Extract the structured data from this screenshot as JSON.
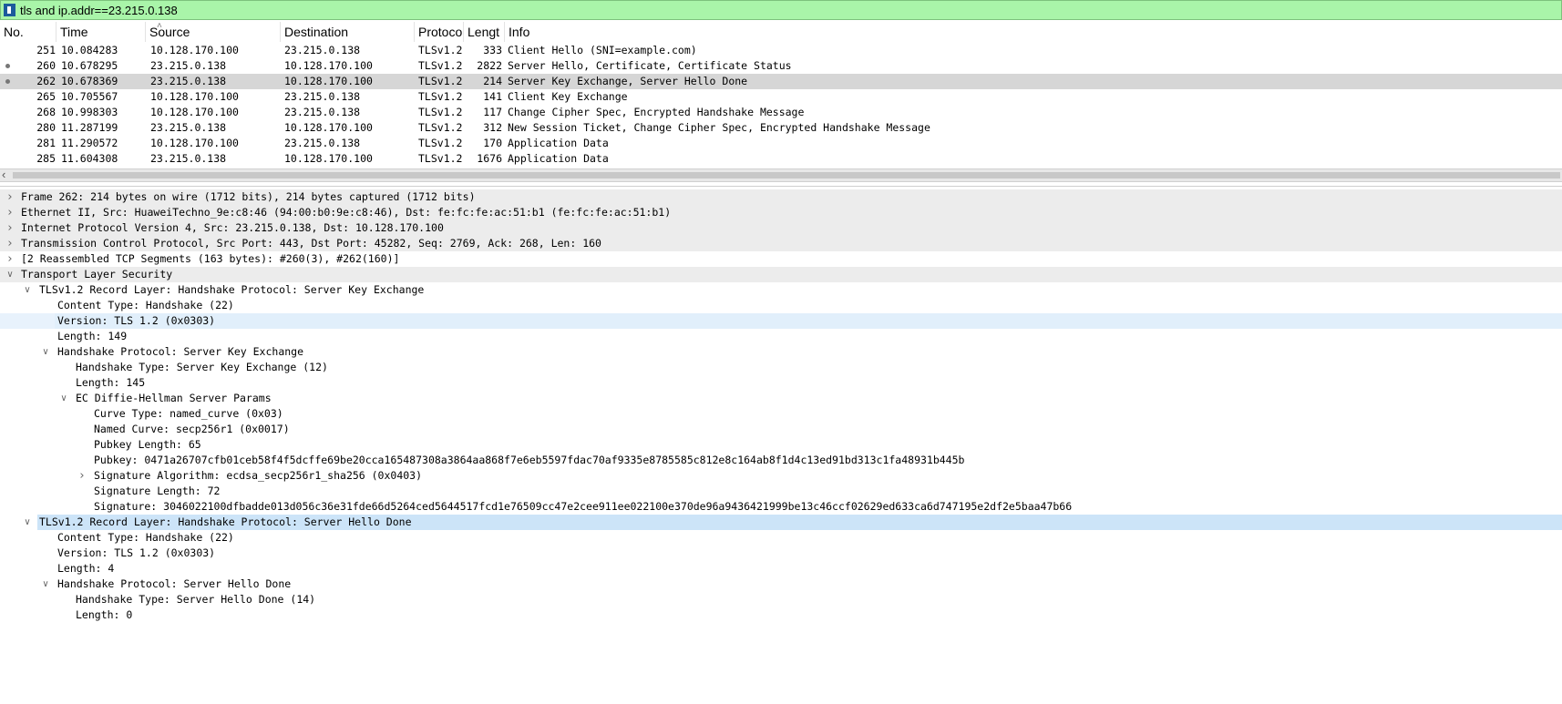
{
  "filter": {
    "value": "tls and ip.addr==23.215.0.138"
  },
  "columns": [
    "No.",
    "Time",
    "Source",
    "Destination",
    "Protoco",
    "Lengt",
    "Info"
  ],
  "packets": [
    {
      "no": "251",
      "time": "10.084283",
      "src": "10.128.170.100",
      "dst": "23.215.0.138",
      "proto": "TLSv1.2",
      "len": "333",
      "info": "Client Hello (SNI=example.com)"
    },
    {
      "no": "260",
      "time": "10.678295",
      "src": "23.215.0.138",
      "dst": "10.128.170.100",
      "proto": "TLSv1.2",
      "len": "2822",
      "info": "Server Hello, Certificate, Certificate Status"
    },
    {
      "no": "262",
      "time": "10.678369",
      "src": "23.215.0.138",
      "dst": "10.128.170.100",
      "proto": "TLSv1.2",
      "len": "214",
      "info": "Server Key Exchange, Server Hello Done"
    },
    {
      "no": "265",
      "time": "10.705567",
      "src": "10.128.170.100",
      "dst": "23.215.0.138",
      "proto": "TLSv1.2",
      "len": "141",
      "info": "Client Key Exchange"
    },
    {
      "no": "268",
      "time": "10.998303",
      "src": "10.128.170.100",
      "dst": "23.215.0.138",
      "proto": "TLSv1.2",
      "len": "117",
      "info": "Change Cipher Spec, Encrypted Handshake Message"
    },
    {
      "no": "280",
      "time": "11.287199",
      "src": "23.215.0.138",
      "dst": "10.128.170.100",
      "proto": "TLSv1.2",
      "len": "312",
      "info": "New Session Ticket, Change Cipher Spec, Encrypted Handshake Message"
    },
    {
      "no": "281",
      "time": "11.290572",
      "src": "10.128.170.100",
      "dst": "23.215.0.138",
      "proto": "TLSv1.2",
      "len": "170",
      "info": "Application Data"
    },
    {
      "no": "285",
      "time": "11.604308",
      "src": "23.215.0.138",
      "dst": "10.128.170.100",
      "proto": "TLSv1.2",
      "len": "1676",
      "info": "Application Data"
    }
  ],
  "details": [
    {
      "text": "Frame 262: 214 bytes on wire (1712 bits), 214 bytes captured (1712 bits)",
      "toggle": "collapsed"
    },
    {
      "text": "Ethernet II, Src: HuaweiTechno_9e:c8:46 (94:00:b0:9e:c8:46), Dst: fe:fc:fe:ac:51:b1 (fe:fc:fe:ac:51:b1)",
      "toggle": "collapsed"
    },
    {
      "text": "Internet Protocol Version 4, Src: 23.215.0.138, Dst: 10.128.170.100",
      "toggle": "collapsed"
    },
    {
      "text": "Transmission Control Protocol, Src Port: 443, Dst Port: 45282, Seq: 2769, Ack: 268, Len: 160",
      "toggle": "collapsed"
    },
    {
      "text": "[2 Reassembled TCP Segments (163 bytes): #260(3), #262(160)]",
      "toggle": "collapsed"
    },
    {
      "text": "Transport Layer Security",
      "toggle": "expanded"
    },
    {
      "text": "TLSv1.2 Record Layer: Handshake Protocol: Server Key Exchange",
      "toggle": "expanded"
    },
    {
      "text": "Content Type: Handshake (22)",
      "toggle": "none"
    },
    {
      "text": "Version: TLS 1.2 (0x0303)",
      "toggle": "none"
    },
    {
      "text": "Length: 149",
      "toggle": "none"
    },
    {
      "text": "Handshake Protocol: Server Key Exchange",
      "toggle": "expanded"
    },
    {
      "text": "Handshake Type: Server Key Exchange (12)",
      "toggle": "none"
    },
    {
      "text": "Length: 145",
      "toggle": "none"
    },
    {
      "text": "EC Diffie-Hellman Server Params",
      "toggle": "expanded"
    },
    {
      "text": "Curve Type: named_curve (0x03)",
      "toggle": "none"
    },
    {
      "text": "Named Curve: secp256r1 (0x0017)",
      "toggle": "none"
    },
    {
      "text": "Pubkey Length: 65",
      "toggle": "none"
    },
    {
      "text": "Pubkey: 0471a26707cfb01ceb58f4f5dcffe69be20cca165487308a3864aa868f7e6eb5597fdac70af9335e8785585c812e8c164ab8f1d4c13ed91bd313c1fa48931b445b",
      "toggle": "none"
    },
    {
      "text": "Signature Algorithm: ecdsa_secp256r1_sha256 (0x0403)",
      "toggle": "collapsed"
    },
    {
      "text": "Signature Length: 72",
      "toggle": "none"
    },
    {
      "text": "Signature: 3046022100dfbadde013d056c36e31fde66d5264ced5644517fcd1e76509cc47e2cee911ee022100e370de96a9436421999be13c46ccf02629ed633ca6d747195e2df2e5baa47b66",
      "toggle": "none"
    },
    {
      "text": "TLSv1.2 Record Layer: Handshake Protocol: Server Hello Done",
      "toggle": "expanded"
    },
    {
      "text": "Content Type: Handshake (22)",
      "toggle": "none"
    },
    {
      "text": "Version: TLS 1.2 (0x0303)",
      "toggle": "none"
    },
    {
      "text": "Length: 4",
      "toggle": "none"
    },
    {
      "text": "Handshake Protocol: Server Hello Done",
      "toggle": "expanded"
    },
    {
      "text": "Handshake Type: Server Hello Done (14)",
      "toggle": "none"
    },
    {
      "text": "Length: 0",
      "toggle": "none"
    }
  ]
}
